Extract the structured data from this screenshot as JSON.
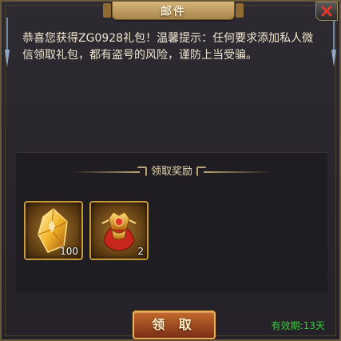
{
  "dialog": {
    "title": "邮件",
    "message": "恭喜您获得ZG0928礼包！温馨提示：任何要求添加私人微信领取礼包，都有盗号的风险，谨防上当受骗。"
  },
  "rewards": {
    "header": "领取奖励",
    "items": [
      {
        "icon": "gold-crystal-icon",
        "count": "100"
      },
      {
        "icon": "golden-armor-icon",
        "count": "2"
      }
    ]
  },
  "footer": {
    "claim_label": "领 取",
    "expiry": "有效期:13天"
  },
  "colors": {
    "frame_border": "#6b5a3a",
    "slot_border": "#c79a3a",
    "claim_button": "#c56a2e",
    "expiry_text": "#39d13b"
  }
}
